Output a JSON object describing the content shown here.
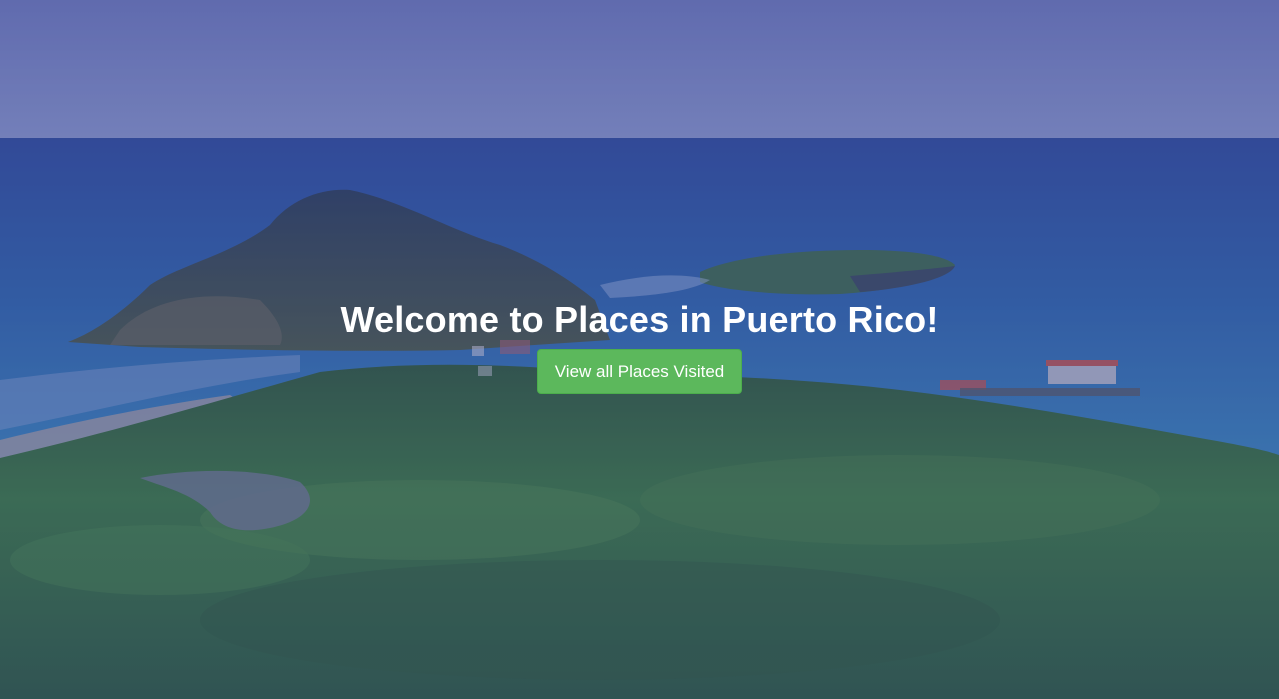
{
  "hero": {
    "title": "Welcome to Places in Puerto Rico!",
    "button_label": "View all Places Visited",
    "background_image": "coastal-landscape-with-islands-photo"
  },
  "colors": {
    "button": "#5cb85c",
    "title_text": "#ffffff",
    "overlay": "#3c4696"
  }
}
